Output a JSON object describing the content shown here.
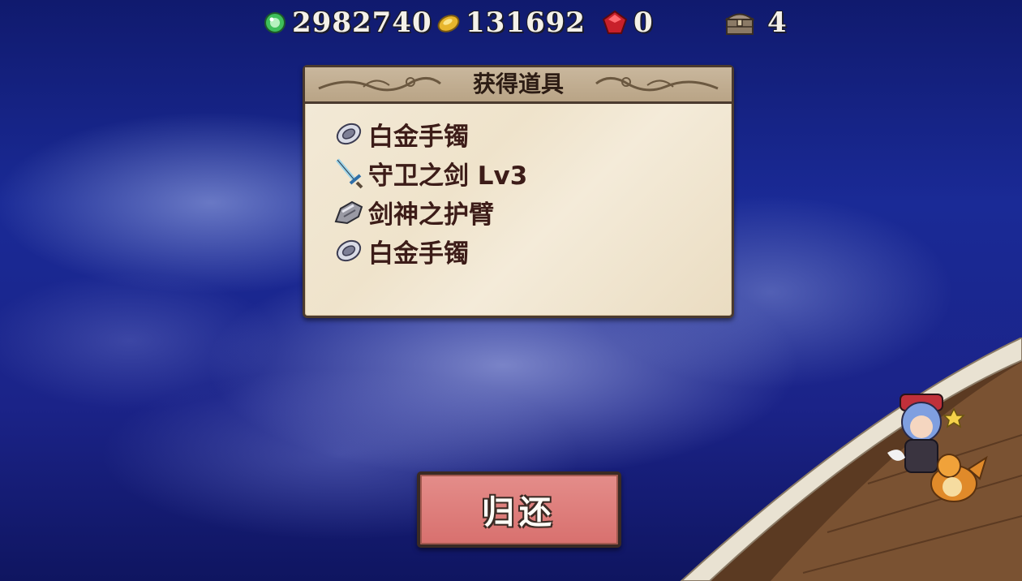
{
  "resources": {
    "green_gem": {
      "icon": "green-gem-icon",
      "value": "2982740"
    },
    "gold_coin": {
      "icon": "gold-coin-icon",
      "value": "131692"
    },
    "red_gem": {
      "icon": "red-gem-icon",
      "value": "0"
    },
    "chest": {
      "icon": "treasure-chest-icon",
      "value": "4"
    }
  },
  "panel": {
    "title": "获得道具",
    "items": [
      {
        "icon": "ring-icon",
        "name": "白金手镯"
      },
      {
        "icon": "sword-icon",
        "name": "守卫之剑 Lv3"
      },
      {
        "icon": "gauntlet-icon",
        "name": "剑神之护臂"
      },
      {
        "icon": "ring-icon",
        "name": "白金手镯"
      }
    ]
  },
  "return_button": {
    "label": "归还"
  }
}
